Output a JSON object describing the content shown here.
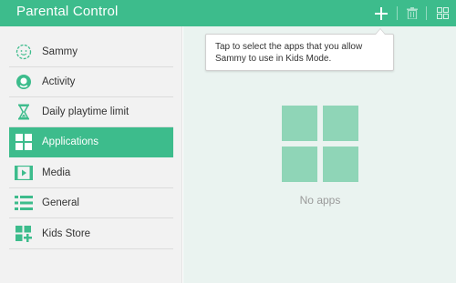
{
  "header": {
    "title": "Parental Control",
    "add_icon": "plus-icon",
    "delete_icon": "trash-icon",
    "grid_icon": "grid-view-icon"
  },
  "sidebar": {
    "items": [
      {
        "label": "Sammy",
        "icon": "child-face-icon",
        "selected": false
      },
      {
        "label": "Activity",
        "icon": "activity-icon",
        "selected": false
      },
      {
        "label": "Daily playtime limit",
        "icon": "hourglass-icon",
        "selected": false
      },
      {
        "label": "Applications",
        "icon": "applications-grid-icon",
        "selected": true
      },
      {
        "label": "Media",
        "icon": "media-film-icon",
        "selected": false
      },
      {
        "label": "General",
        "icon": "general-list-icon",
        "selected": false
      },
      {
        "label": "Kids Store",
        "icon": "kids-store-icon",
        "selected": false
      }
    ]
  },
  "main": {
    "tooltip": "Tap to select the apps that you allow Sammy to use in Kids Mode.",
    "empty_icon": "apps-placeholder-icon",
    "empty_label": "No apps"
  },
  "colors": {
    "accent": "#3dbc8c",
    "sidebar_bg": "#f2f2f2",
    "main_bg": "#eaf3f0",
    "placeholder": "#8fd5b7"
  }
}
